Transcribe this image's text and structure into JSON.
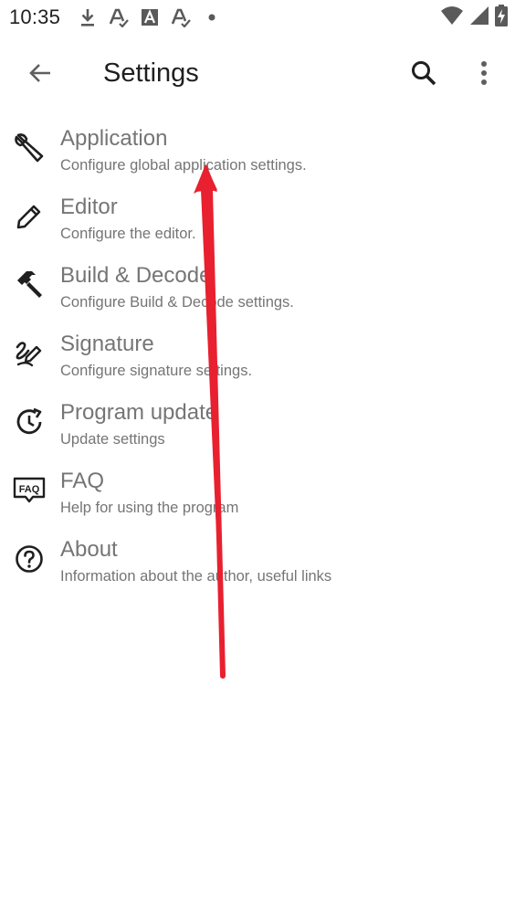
{
  "status_bar": {
    "time": "10:35",
    "left_icons": [
      "download-icon",
      "font-a-check-icon",
      "font-a-box-icon",
      "font-a-check-icon",
      "dot-icon"
    ],
    "right_icons": [
      "wifi-icon",
      "signal-icon",
      "battery-charging-icon"
    ]
  },
  "app_bar": {
    "title": "Settings",
    "back_icon": "arrow-back-icon",
    "search_icon": "search-icon",
    "more_icon": "more-vert-icon"
  },
  "settings": {
    "items": [
      {
        "title": "Application",
        "subtitle": "Configure global application settings.",
        "icon": "wrench-icon"
      },
      {
        "title": "Editor",
        "subtitle": "Configure the editor.",
        "icon": "pencil-icon"
      },
      {
        "title": "Build & Decode",
        "subtitle": "Configure Build & Decode settings.",
        "icon": "hammer-icon"
      },
      {
        "title": "Signature",
        "subtitle": "Configure signature settings.",
        "icon": "signature-icon"
      },
      {
        "title": "Program update",
        "subtitle": "Update settings",
        "icon": "update-icon"
      },
      {
        "title": "FAQ",
        "subtitle": "Help for using the program",
        "icon": "faq-icon"
      },
      {
        "title": "About",
        "subtitle": "Information about the author, useful links",
        "icon": "help-circle-icon"
      }
    ]
  },
  "colors": {
    "text_primary": "#1f1f1f",
    "text_secondary": "#757575",
    "annotation_arrow": "#e8202f"
  }
}
